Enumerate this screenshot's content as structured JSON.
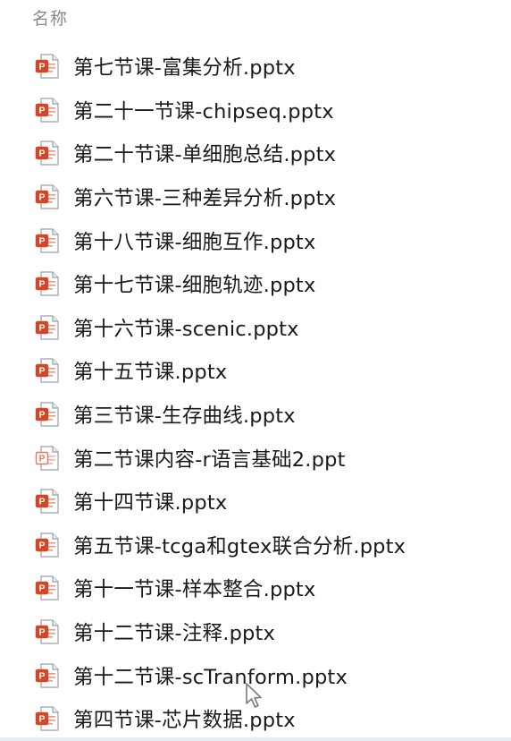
{
  "header": {
    "name_column": "名称"
  },
  "files": [
    {
      "name": "第七节课-富集分析.pptx",
      "icon": "pptx-icon"
    },
    {
      "name": "第二十一节课-chipseq.pptx",
      "icon": "pptx-icon"
    },
    {
      "name": "第二十节课-单细胞总结.pptx",
      "icon": "pptx-icon"
    },
    {
      "name": "第六节课-三种差异分析.pptx",
      "icon": "pptx-icon"
    },
    {
      "name": "第十八节课-细胞互作.pptx",
      "icon": "pptx-icon"
    },
    {
      "name": "第十七节课-细胞轨迹.pptx",
      "icon": "pptx-icon"
    },
    {
      "name": "第十六节课-scenic.pptx",
      "icon": "pptx-icon"
    },
    {
      "name": "第十五节课.pptx",
      "icon": "pptx-icon"
    },
    {
      "name": "第三节课-生存曲线.pptx",
      "icon": "pptx-icon"
    },
    {
      "name": "第二节课内容-r语言基础2.ppt",
      "icon": "ppt-icon"
    },
    {
      "name": "第十四节课.pptx",
      "icon": "pptx-icon"
    },
    {
      "name": "第五节课-tcga和gtex联合分析.pptx",
      "icon": "pptx-icon"
    },
    {
      "name": "第十一节课-样本整合.pptx",
      "icon": "pptx-icon"
    },
    {
      "name": "第十二节课-注释.pptx",
      "icon": "pptx-icon"
    },
    {
      "name": "第十二节课-scTranform.pptx",
      "icon": "pptx-icon"
    },
    {
      "name": "第四节课-芯片数据.pptx",
      "icon": "pptx-icon"
    }
  ],
  "colors": {
    "pptx_accent": "#d24726",
    "ppt_accent": "#e07a5f",
    "text": "#1a1a1a",
    "header_text": "#8a8a8a"
  }
}
